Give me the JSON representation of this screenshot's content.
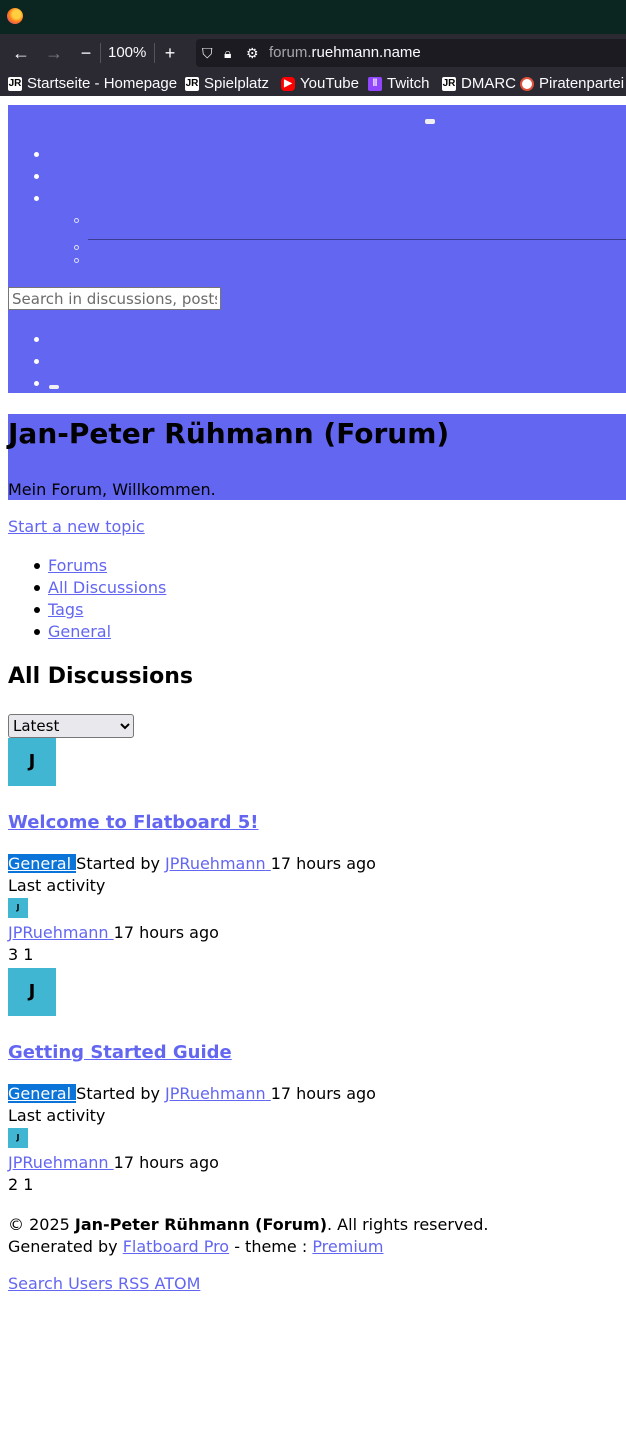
{
  "browser": {
    "zoom": "100%",
    "url_prefix": "forum.",
    "url_domain": "ruehmann.name",
    "bookmarks": [
      {
        "label": "Startseite - Homepage",
        "icon": "jr-logo-icon"
      },
      {
        "label": "Spielplatz",
        "icon": "jr-logo-icon"
      },
      {
        "label": "YouTube",
        "icon": "youtube-icon"
      },
      {
        "label": "Twitch",
        "icon": "twitch-icon"
      },
      {
        "label": "DMARC",
        "icon": "jr-logo-icon"
      },
      {
        "label": "Piratenpartei",
        "icon": "piratenpartei-icon"
      }
    ]
  },
  "nav": {
    "search_placeholder": "Search in discussions, posts"
  },
  "site": {
    "title": "Jan-Peter Rühmann (Forum)",
    "subtitle": "Mein Forum, Willkommen."
  },
  "actions": {
    "new_topic": "Start a new topic"
  },
  "breadcrumbs": [
    "Forums",
    "All Discussions",
    "Tags",
    "General"
  ],
  "page": {
    "title": "All Discussions",
    "sort_selected": "Latest"
  },
  "discussions": [
    {
      "avatar_letter": "J",
      "title": "Welcome to Flatboard 5!",
      "tag": "General",
      "started_by_label": "Started by",
      "author": "JPRuehmann",
      "started_time": "17 hours ago",
      "last_activity_label": "Last activity",
      "last_avatar_letter": "J",
      "last_user": "JPRuehmann",
      "last_time": "17 hours ago",
      "counts": "3 1"
    },
    {
      "avatar_letter": "J",
      "title": "Getting Started Guide",
      "tag": "General",
      "started_by_label": "Started by",
      "author": "JPRuehmann",
      "started_time": "17 hours ago",
      "last_activity_label": "Last activity",
      "last_avatar_letter": "J",
      "last_user": "JPRuehmann",
      "last_time": "17 hours ago",
      "counts": "2 1"
    }
  ],
  "footer": {
    "copyright_prefix": "© 2025",
    "copyright_name": "Jan-Peter Rühmann (Forum)",
    "copyright_suffix": ". All rights reserved.",
    "generated_by": "Generated by",
    "flatboard_link": "Flatboard Pro",
    "theme_text": "- theme :",
    "theme_link": "Premium",
    "links": [
      "Search",
      "Users",
      "RSS",
      "ATOM"
    ]
  },
  "colors": {
    "accent": "#6366f1",
    "avatar": "#40b6d3",
    "tag_bg": "#0a74d8",
    "titlebar": "#0b2620",
    "toolbar": "#2b2a33"
  }
}
